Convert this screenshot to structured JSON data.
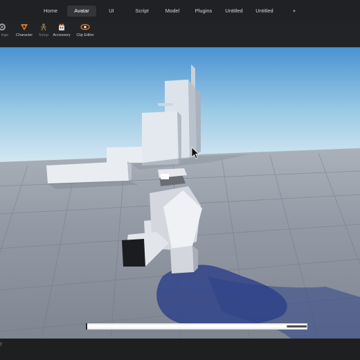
{
  "tabs": [
    {
      "label": "Home",
      "active": false
    },
    {
      "label": "Avatar",
      "active": true
    },
    {
      "label": "UI",
      "active": false
    },
    {
      "label": "Script",
      "active": false
    },
    {
      "label": "Model",
      "active": false
    },
    {
      "label": "Plugins",
      "active": false
    },
    {
      "label": "Untitled",
      "active": false
    },
    {
      "label": "Untitled",
      "active": false
    }
  ],
  "new_tab_label": "+",
  "ribbon": {
    "partial_label": "ings",
    "tools": [
      {
        "label": "Character",
        "icon": "character-icon"
      },
      {
        "label": "Setup",
        "icon": "setup-icon",
        "dim": true
      },
      {
        "label": "Accessory",
        "icon": "accessory-icon"
      },
      {
        "label": "Clip Editor",
        "icon": "clip-editor-icon"
      }
    ]
  },
  "timeline": {
    "progress": 0.91
  },
  "status": {
    "partial_text": "ry"
  },
  "colors": {
    "accent": "#2e6fd6",
    "sky_top": "#4b93d2",
    "sky_horizon": "#d8e9f2",
    "ground": "#8d949f"
  }
}
